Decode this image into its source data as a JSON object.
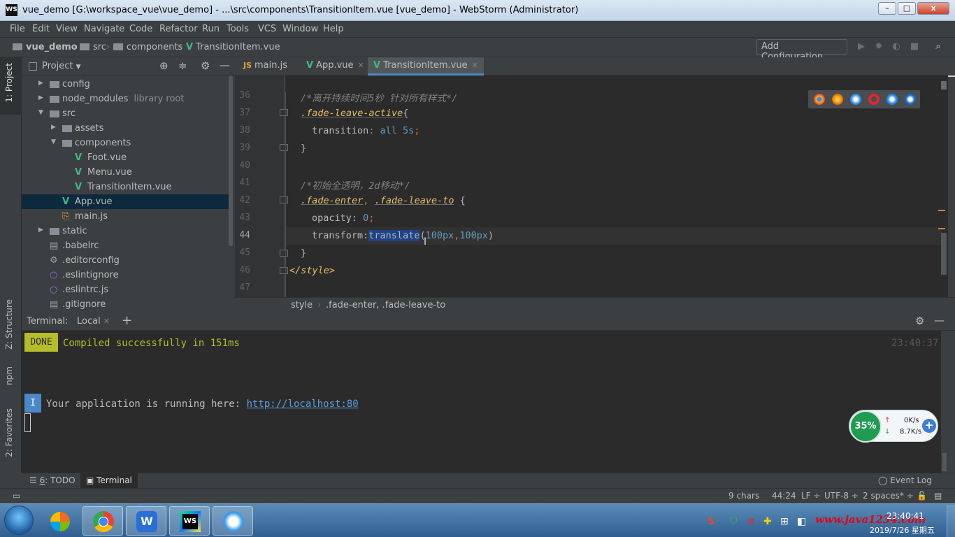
{
  "window": {
    "title": "vue_demo [G:\\workspace_vue\\vue_demo] - ...\\src\\components\\TransitionItem.vue [vue_demo] - WebStorm (Administrator)",
    "logo_text": "WS",
    "min": "–",
    "max": "□",
    "close": "x"
  },
  "menu": [
    "File",
    "Edit",
    "View",
    "Navigate",
    "Code",
    "Refactor",
    "Run",
    "Tools",
    "VCS",
    "Window",
    "Help"
  ],
  "navbar": {
    "project": "vue_demo",
    "crumb1": "src",
    "crumb2": "components",
    "crumb3": "TransitionItem.vue",
    "add_config": "Add Configuration..."
  },
  "left_strip": {
    "project": "1: Project",
    "structure": "Z: Structure",
    "npm": "npm",
    "favorites": "2: Favorites"
  },
  "project_panel": {
    "title": "Project",
    "items": [
      {
        "label": "config",
        "arrow": "▶",
        "indent": 1,
        "type": "folder"
      },
      {
        "label": "node_modules",
        "hint": "library root",
        "arrow": "▶",
        "indent": 1,
        "type": "folder"
      },
      {
        "label": "src",
        "arrow": "▼",
        "indent": 1,
        "type": "folder"
      },
      {
        "label": "assets",
        "arrow": "▶",
        "indent": 2,
        "type": "folder"
      },
      {
        "label": "components",
        "arrow": "▼",
        "indent": 2,
        "type": "folder"
      },
      {
        "label": "Foot.vue",
        "indent": 3,
        "type": "vue"
      },
      {
        "label": "Menu.vue",
        "indent": 3,
        "type": "vue"
      },
      {
        "label": "TransitionItem.vue",
        "indent": 3,
        "type": "vue"
      },
      {
        "label": "App.vue",
        "indent": 2,
        "type": "vue",
        "selected": true
      },
      {
        "label": "main.js",
        "indent": 2,
        "type": "js"
      },
      {
        "label": "static",
        "arrow": "▶",
        "indent": 1,
        "type": "folder"
      },
      {
        "label": ".babelrc",
        "indent": 1,
        "type": "file"
      },
      {
        "label": ".editorconfig",
        "indent": 1,
        "type": "gear"
      },
      {
        "label": ".eslintignore",
        "indent": 1,
        "type": "circle"
      },
      {
        "label": ".eslintrc.js",
        "indent": 1,
        "type": "circle"
      },
      {
        "label": ".gitignore",
        "indent": 1,
        "type": "file"
      }
    ]
  },
  "tabs": [
    {
      "label": "main.js"
    },
    {
      "label": "App.vue"
    },
    {
      "label": "TransitionItem.vue",
      "active": true
    }
  ],
  "code": {
    "line_numbers": [
      "36",
      "37",
      "38",
      "39",
      "40",
      "41",
      "42",
      "43",
      "44",
      "45",
      "46",
      "47"
    ],
    "l36": "/*离开持续时间5秒 针对所有样式*/",
    "l37_sel": ".fade-leave-active",
    "l37_brace": "{",
    "l38_prop": "transition",
    "l38_val": ": all 5s",
    "l38_semi": ";",
    "l39": "}",
    "l41": "/*初始全透明，2d移动*/",
    "l42_sel1": ".fade-enter",
    "l42_comma": ", ",
    "l42_sel2": ".fade-leave-to",
    "l42_brace": " {",
    "l43_prop": "opacity",
    "l43_colon": ": ",
    "l43_val": "0",
    "l43_semi": ";",
    "l44_prop": "transform",
    "l44_colon": ":",
    "l44_fn": "translate",
    "l44_args_open": "(",
    "l44_arg1": "100px",
    "l44_comma": ",",
    "l44_arg2": "100px",
    "l44_close": ")",
    "l45": "}",
    "l46": "</style>"
  },
  "editor_breadcrumb": {
    "a": "style",
    "b": ".fade-enter, .fade-leave-to"
  },
  "ime": {
    "logo": "S",
    "lang": "英"
  },
  "terminal": {
    "label": "Terminal:",
    "tab": "Local",
    "done": "DONE",
    "compiled": "Compiled successfully in 151ms",
    "time": "23:40:37",
    "i": "I",
    "running": "Your application is running here: ",
    "url": "http://localhost:80"
  },
  "speed": {
    "percent": "35%",
    "up": "0K/s",
    "down": "8.7K/s"
  },
  "bottom_tabs": {
    "todo_num": "6",
    "todo": ": TODO",
    "terminal": "Terminal",
    "event_log": "Event Log"
  },
  "status": {
    "chars": "9 chars",
    "pos": "44:24",
    "lf": "LF ÷",
    "enc": "UTF-8 ÷",
    "indent": "2 spaces* ÷"
  },
  "taskbar": {
    "watermark": "www.java1234.com",
    "time": "23:40:41",
    "date": "2019/7/26 星期五"
  },
  "colors": {
    "accent": "#4a88c7",
    "vue": "#41b883",
    "done_bg": "#b5bd2a"
  }
}
